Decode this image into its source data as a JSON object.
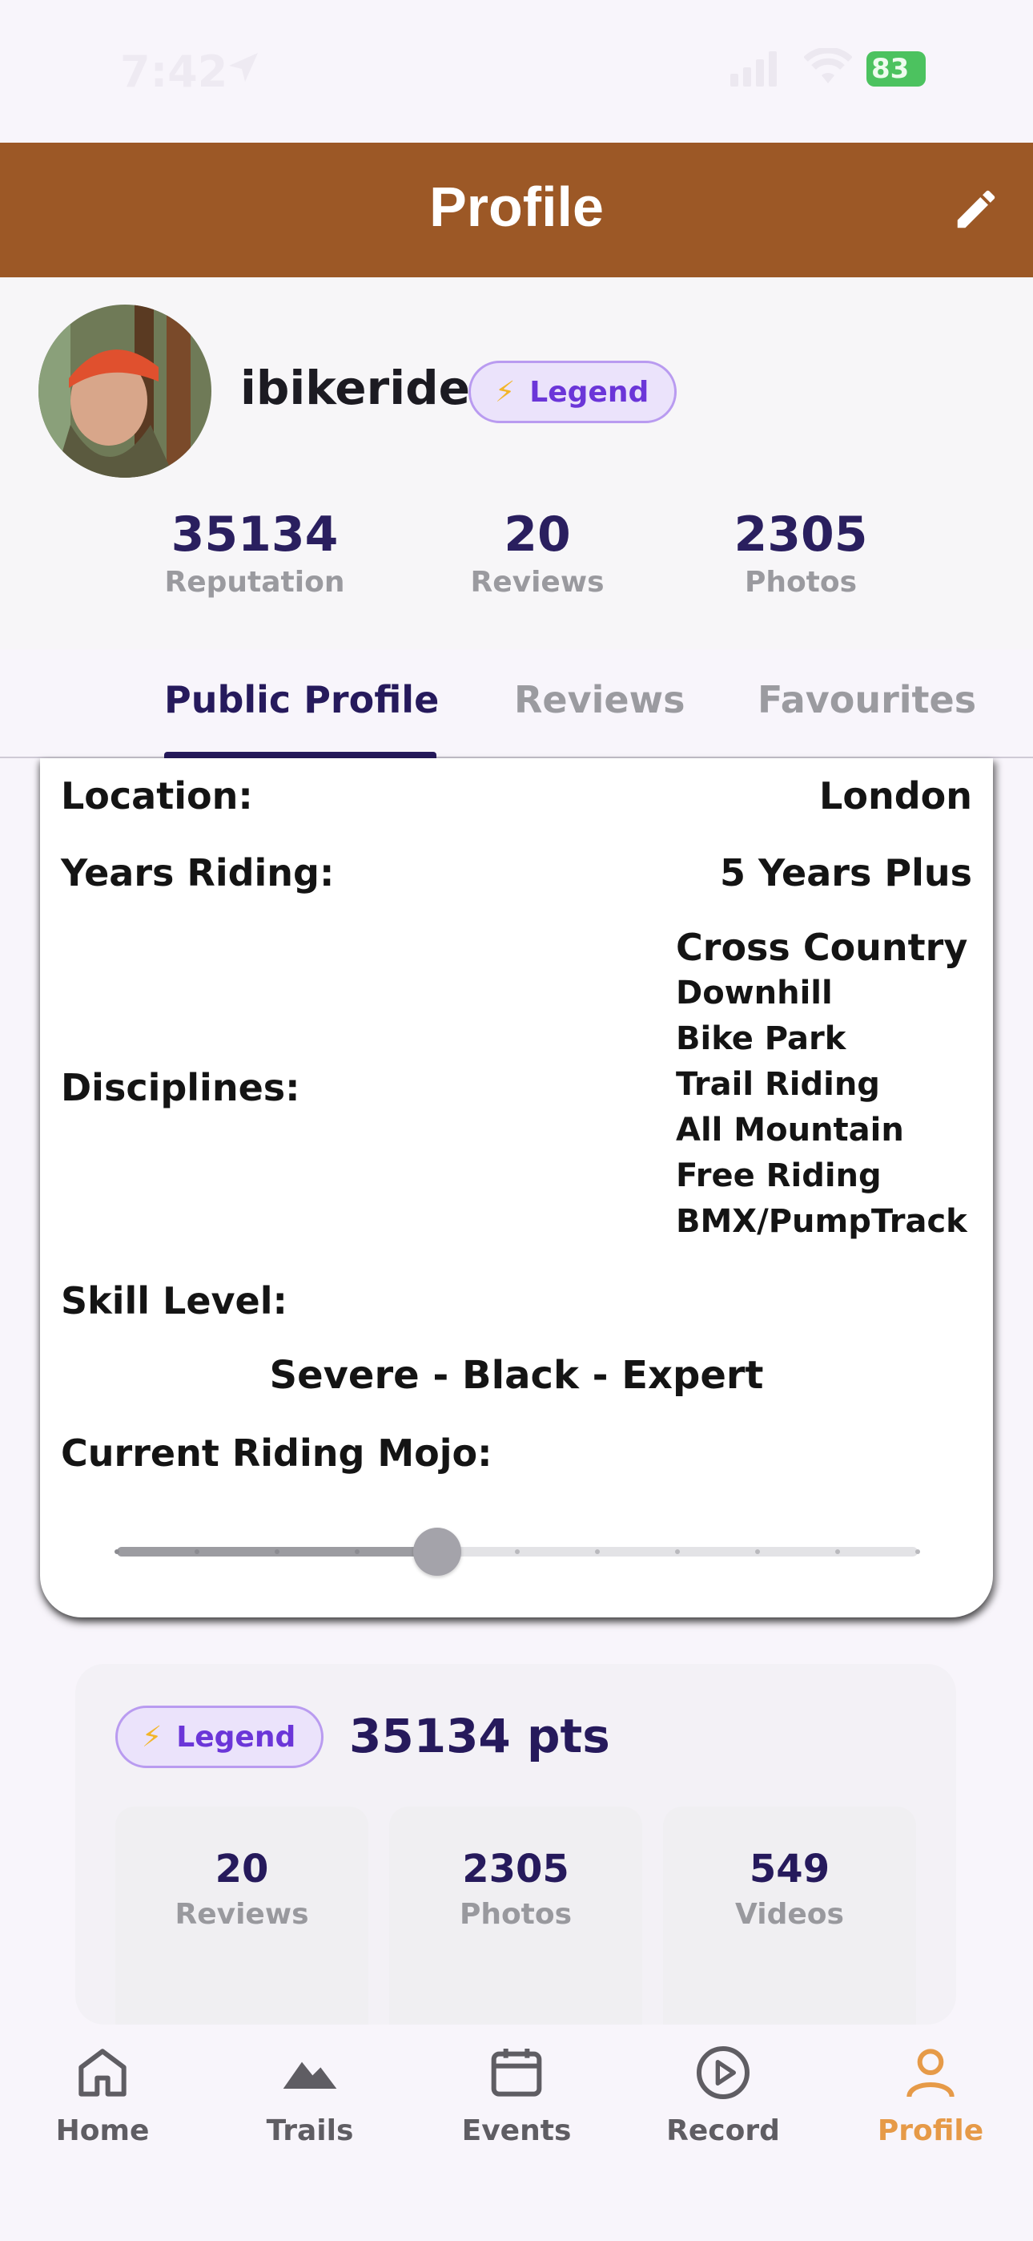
{
  "status_bar": {
    "time": "7:42",
    "battery": "83"
  },
  "header": {
    "title": "Profile",
    "edit_icon": "pencil-icon"
  },
  "profile": {
    "username": "ibikeride",
    "badge": "Legend",
    "stats": [
      {
        "value": "35134",
        "label": "Reputation"
      },
      {
        "value": "20",
        "label": "Reviews"
      },
      {
        "value": "2305",
        "label": "Photos"
      }
    ]
  },
  "tabs": [
    {
      "label": "Public Profile",
      "active": true
    },
    {
      "label": "Reviews",
      "active": false
    },
    {
      "label": "Favourites",
      "active": false
    }
  ],
  "details": {
    "location_label": "Location:",
    "location_value": "London",
    "years_label": "Years Riding:",
    "years_value": "5 Years Plus",
    "disciplines_label": "Disciplines:",
    "disciplines": [
      "Cross Country",
      "Downhill",
      "Bike Park",
      "Trail Riding",
      "All Mountain",
      "Free Riding",
      "BMX/PumpTrack"
    ],
    "skill_label": "Skill Level:",
    "skill_value": "Severe - Black - Expert",
    "mojo_label": "Current Riding Mojo:",
    "mojo_level": 0.4,
    "mojo_steps": 10
  },
  "points_card": {
    "badge": "Legend",
    "points": "35134 pts",
    "stats": [
      {
        "value": "20",
        "label": "Reviews"
      },
      {
        "value": "2305",
        "label": "Photos"
      },
      {
        "value": "549",
        "label": "Videos"
      }
    ]
  },
  "nav": [
    {
      "label": "Home",
      "icon": "home-icon",
      "active": false
    },
    {
      "label": "Trails",
      "icon": "mountains-icon",
      "active": false
    },
    {
      "label": "Events",
      "icon": "calendar-icon",
      "active": false
    },
    {
      "label": "Record",
      "icon": "play-circle-icon",
      "active": false
    },
    {
      "label": "Profile",
      "icon": "person-icon",
      "active": true
    }
  ],
  "colors": {
    "header": "#9c5826",
    "accent_dark": "#261a5c",
    "badge_text": "#6b36d8",
    "nav_active": "#e69a48"
  }
}
